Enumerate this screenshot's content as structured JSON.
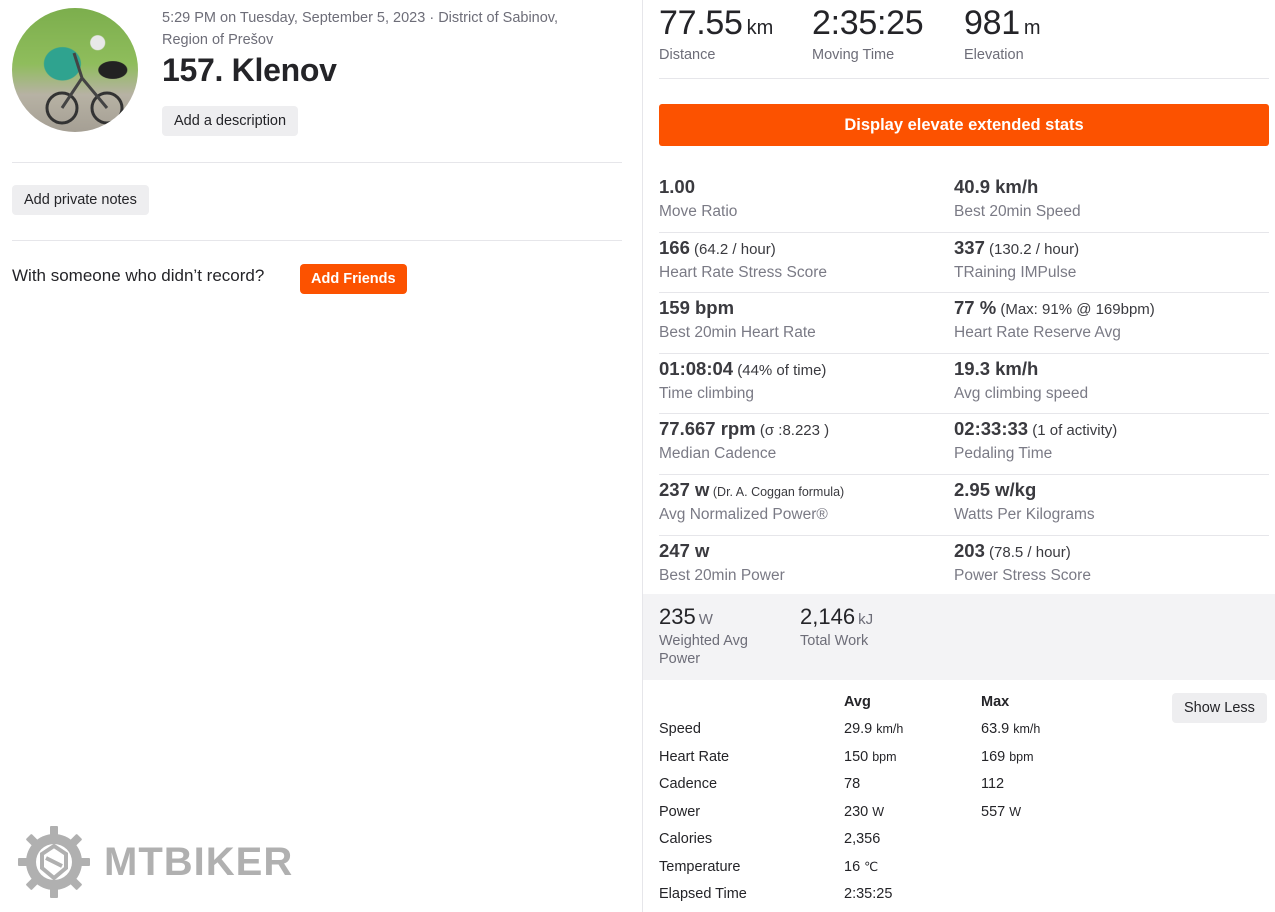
{
  "activity": {
    "meta_line1": "5:29 PM on Tuesday, September 5, 2023 · District of Sabinov,",
    "meta_line2": "Region of Prešov",
    "title": "157. Klenov",
    "add_description_label": "Add a description",
    "add_private_notes_label": "Add private notes",
    "friends_prompt": "With someone who didn’t record?",
    "add_friends_label": "Add Friends",
    "avatar_icon": "rider-photo"
  },
  "watermark": {
    "logo_text": "MTBIKER",
    "logo_icon": "gear-shield-logo"
  },
  "top_stats": [
    {
      "value": "77.55",
      "unit": "km",
      "label": "Distance"
    },
    {
      "value": "2:35:25",
      "unit": "",
      "label": "Moving Time"
    },
    {
      "value": "981",
      "unit": "m",
      "label": "Elevation"
    }
  ],
  "elevate_button_label": "Display elevate extended stats",
  "extended_stats": [
    [
      {
        "value": "1.00",
        "sub": "",
        "label": "Move Ratio"
      },
      {
        "value": "40.9 km/h",
        "sub": "",
        "label": "Best 20min Speed"
      }
    ],
    [
      {
        "value": "166",
        "sub": " (64.2 / hour)",
        "label": "Heart Rate Stress Score"
      },
      {
        "value": "337",
        "sub": " (130.2 / hour)",
        "label": "TRaining IMPulse"
      }
    ],
    [
      {
        "value": "159 bpm",
        "sub": "",
        "label": "Best 20min Heart Rate"
      },
      {
        "value": "77 %",
        "sub": " (Max: 91% @ 169bpm)",
        "label": "Heart Rate Reserve Avg"
      }
    ],
    [
      {
        "value": "01:08:04",
        "sub": " (44% of time)",
        "label": "Time climbing"
      },
      {
        "value": "19.3 km/h",
        "sub": "",
        "label": "Avg climbing speed"
      }
    ],
    [
      {
        "value": "77.667 rpm",
        "sub": " (σ :8.223 )",
        "label": "Median Cadence"
      },
      {
        "value": "02:33:33",
        "sub": " (1 of activity)",
        "label": "Pedaling Time"
      }
    ],
    [
      {
        "value": "237 w",
        "sub": " (Dr. A. Coggan formula)",
        "label": "Avg Normalized Power®"
      },
      {
        "value": "2.95 w/kg",
        "sub": "",
        "label": "Watts Per Kilograms"
      }
    ],
    [
      {
        "value": "247 w",
        "sub": "",
        "label": "Best 20min Power"
      },
      {
        "value": "203",
        "sub": " (78.5 / hour)",
        "label": "Power Stress Score"
      }
    ]
  ],
  "power_stats": [
    {
      "value": "235",
      "unit": "W",
      "label": "Weighted Avg Power"
    },
    {
      "value": "2,146",
      "unit": "kJ",
      "label": "Total Work"
    }
  ],
  "summary_table": {
    "col_avg": "Avg",
    "col_max": "Max",
    "show_less_label": "Show Less",
    "rows": [
      {
        "label": "Speed",
        "avg": "29.9",
        "avg_unit": "km/h",
        "max": "63.9",
        "max_unit": "km/h"
      },
      {
        "label": "Heart Rate",
        "avg": "150",
        "avg_unit": "bpm",
        "max": "169",
        "max_unit": "bpm"
      },
      {
        "label": "Cadence",
        "avg": "78",
        "avg_unit": "",
        "max": "112",
        "max_unit": ""
      },
      {
        "label": "Power",
        "avg": "230",
        "avg_unit": "W",
        "max": "557",
        "max_unit": "W"
      },
      {
        "label": "Calories",
        "avg": "2,356",
        "avg_unit": "",
        "max": "",
        "max_unit": ""
      },
      {
        "label": "Temperature",
        "avg": "16",
        "avg_unit": "℃",
        "max": "",
        "max_unit": ""
      },
      {
        "label": "Elapsed Time",
        "avg": "2:35:25",
        "avg_unit": "",
        "max": "",
        "max_unit": ""
      }
    ]
  },
  "colors": {
    "accent": "#fc5200",
    "text": "#242428",
    "muted": "#6d6d78",
    "panel": "#f3f3f5"
  }
}
